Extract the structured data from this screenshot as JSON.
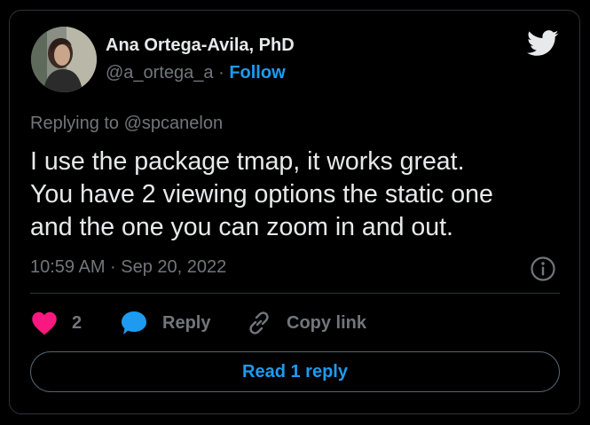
{
  "author": {
    "display_name": "Ana Ortega-Avila, PhD",
    "handle": "@a_ortega_a",
    "separator": "·",
    "follow_label": "Follow"
  },
  "tweet": {
    "replying_to": "Replying to @spcanelon",
    "lines": [
      "I use the package tmap, it works great.",
      "You have 2 viewing options the static one",
      "and the one you can zoom in and out."
    ],
    "timestamp": "10:59 AM · Sep 20, 2022"
  },
  "actions": {
    "like_count": "2",
    "reply_label": "Reply",
    "copy_label": "Copy link"
  },
  "read_reply_label": "Read 1 reply",
  "icons": {
    "brand": "twitter-bird-icon",
    "like": "heart-icon",
    "reply": "speech-bubble-icon",
    "copy": "link-icon",
    "info": "info-icon"
  },
  "colors": {
    "background": "#000000",
    "text": "#e7e9ea",
    "muted": "#71767b",
    "accent": "#1d9bf0",
    "like": "#f91880",
    "border": "#2f3336"
  }
}
